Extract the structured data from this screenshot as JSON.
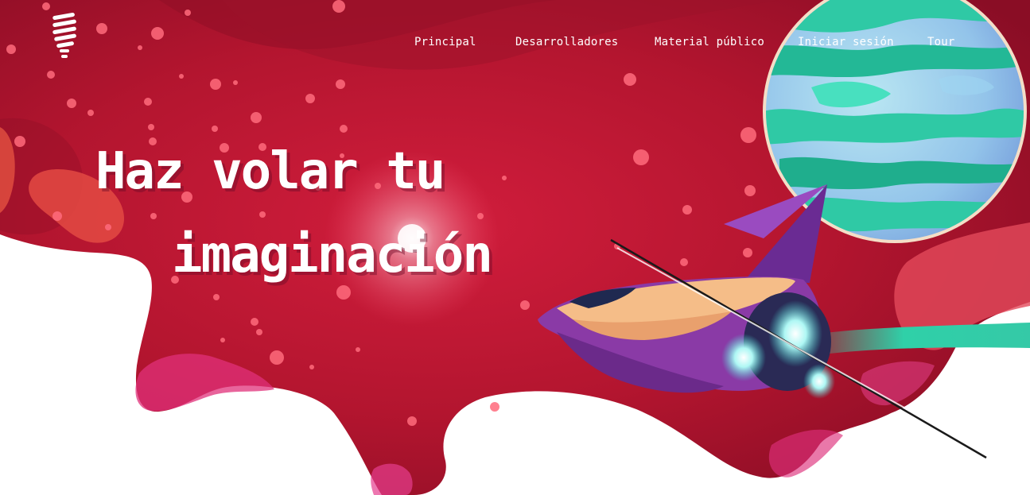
{
  "nav": {
    "items": [
      {
        "label": "Principal"
      },
      {
        "label": "Desarrolladores"
      },
      {
        "label": "Material público"
      },
      {
        "label": "Iniciar sesión"
      },
      {
        "label": "Tour"
      }
    ]
  },
  "hero": {
    "headline_line1": "Haz volar tu",
    "headline_line2": "imaginación"
  },
  "icons": {
    "logo": "lightbulb-logo-icon",
    "planet": "planet-illustration",
    "spaceship": "spaceship-illustration"
  },
  "colors": {
    "background": "#ffffff",
    "hero_red": "#b8162f",
    "hero_dark": "#7e0c22",
    "blob_coral": "#e2483f",
    "blob_pink": "#e0307a",
    "planet_teal": "#2fc9a5",
    "planet_blue": "#8fb8e6",
    "ship_purple": "#8a3aa6",
    "ship_peach": "#f5bd88",
    "engine_cyan": "#7ff0ec"
  }
}
